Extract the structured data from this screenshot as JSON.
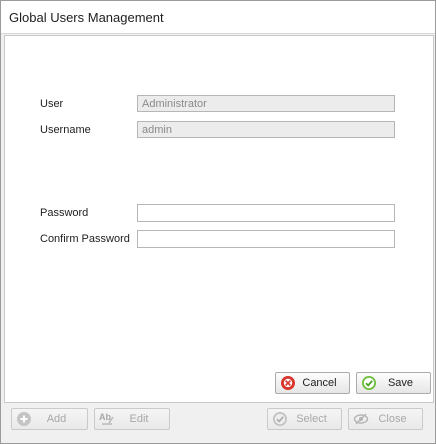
{
  "window": {
    "title": "Global Users Management"
  },
  "form": {
    "user_label": "User",
    "user_value": "Administrator",
    "username_label": "Username",
    "username_value": "admin",
    "password_label": "Password",
    "password_value": "",
    "confirm_label": "Confirm Password",
    "confirm_value": ""
  },
  "actions": {
    "cancel_label": "Cancel",
    "save_label": "Save"
  },
  "toolbar": {
    "add_label": "Add",
    "edit_label": "Edit",
    "select_label": "Select",
    "close_label": "Close"
  },
  "colors": {
    "cancel_icon": "#d9342b",
    "save_icon": "#6cbf3a",
    "disabled_icon": "#b9b9b9"
  },
  "icons": {
    "cancel": "cancel-icon",
    "save": "save-check-icon",
    "add": "add-icon",
    "edit": "edit-text-icon",
    "select": "select-check-icon",
    "close": "close-eye-icon"
  }
}
